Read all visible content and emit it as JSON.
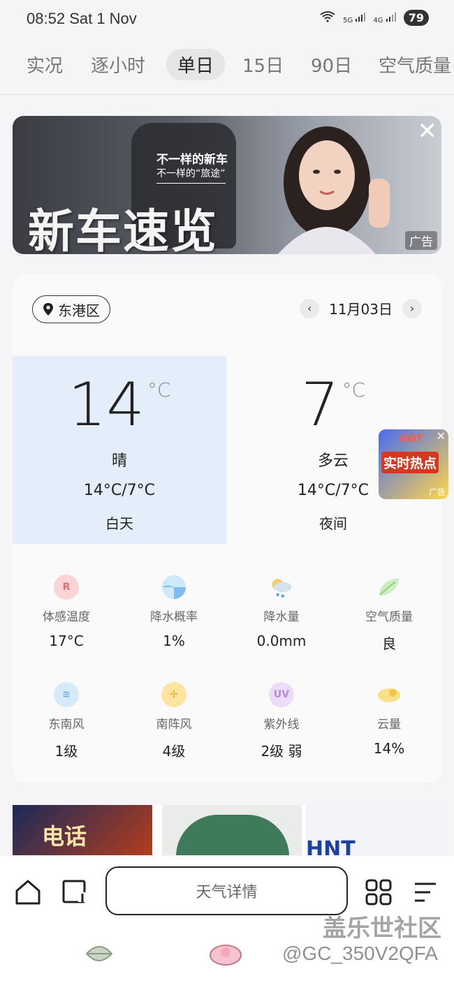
{
  "status_bar": {
    "time": "08:52",
    "date": "Sat 1 Nov",
    "battery": "79",
    "net1": "5G",
    "net2": "4G"
  },
  "tabs": [
    {
      "label": "实况"
    },
    {
      "label": "逐小时"
    },
    {
      "label": "单日"
    },
    {
      "label": "15日"
    },
    {
      "label": "90日"
    },
    {
      "label": "空气质量"
    }
  ],
  "top_ad": {
    "line1": "不一样的新车",
    "line2": "不一样的“旅途”",
    "title": "新车速览",
    "tag": "广告"
  },
  "location": {
    "name": "东港区"
  },
  "date_nav": {
    "date": "11月03日"
  },
  "day": {
    "temp": "14",
    "unit": "°C",
    "condition": "晴",
    "range": "14°C/7°C",
    "period": "白天"
  },
  "night": {
    "temp": "7",
    "unit": "°C",
    "condition": "多云",
    "range": "14°C/7°C",
    "period": "夜间"
  },
  "float_ad": {
    "hot": "HOT",
    "title": "实时热点",
    "tag": "广告"
  },
  "details": [
    {
      "label": "体感温度",
      "value": "17°C",
      "icon_text": "R",
      "icon": "feels-like-icon",
      "color": "#f7b8b8"
    },
    {
      "label": "降水概率",
      "value": "1%",
      "icon_text": "",
      "icon": "precip-probability-icon",
      "color": "#a8d4f5"
    },
    {
      "label": "降水量",
      "value": "0.0mm",
      "icon_text": "",
      "icon": "rain-cloud-icon",
      "color": "#f5cf6a"
    },
    {
      "label": "空气质量",
      "value": "良",
      "icon_text": "",
      "icon": "leaf-icon",
      "color": "#bfe3b0"
    },
    {
      "label": "东南风",
      "value": "1级",
      "icon_text": "≋",
      "icon": "wind-icon",
      "color": "#bfe0f7"
    },
    {
      "label": "南阵风",
      "value": "4级",
      "icon_text": "✢",
      "icon": "gust-icon",
      "color": "#fbd66a"
    },
    {
      "label": "紫外线",
      "value": "2级 弱",
      "icon_text": "UV",
      "icon": "uv-icon",
      "color": "#e3cdf3"
    },
    {
      "label": "云量",
      "value": "14%",
      "icon_text": "",
      "icon": "cloud-cover-icon",
      "color": "#fbd66a"
    }
  ],
  "news": {
    "item1": "电话",
    "item3": "HNT"
  },
  "bottom": {
    "details_button": "天气详情",
    "watermark_site": "盖乐世社区",
    "watermark_user": "@GC_350V2QFA"
  }
}
